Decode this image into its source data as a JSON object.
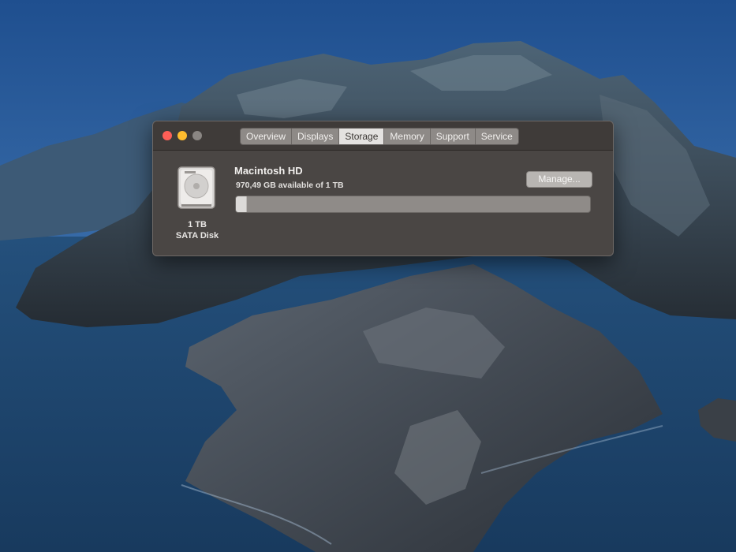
{
  "window": {
    "tabs": [
      {
        "label": "Overview",
        "active": false
      },
      {
        "label": "Displays",
        "active": false
      },
      {
        "label": "Storage",
        "active": true
      },
      {
        "label": "Memory",
        "active": false
      },
      {
        "label": "Support",
        "active": false
      },
      {
        "label": "Service",
        "active": false
      }
    ]
  },
  "storage": {
    "disk": {
      "size": "1 TB",
      "type": "SATA Disk",
      "icon": "hard-drive-icon"
    },
    "volume_name": "Macintosh HD",
    "available_text": "970,49 GB available of 1 TB",
    "used_fraction": 0.03,
    "manage_label": "Manage..."
  },
  "colors": {
    "close": "#fe5f57",
    "minimize": "#febc2e",
    "zoom_inactive": "#8a8683"
  }
}
